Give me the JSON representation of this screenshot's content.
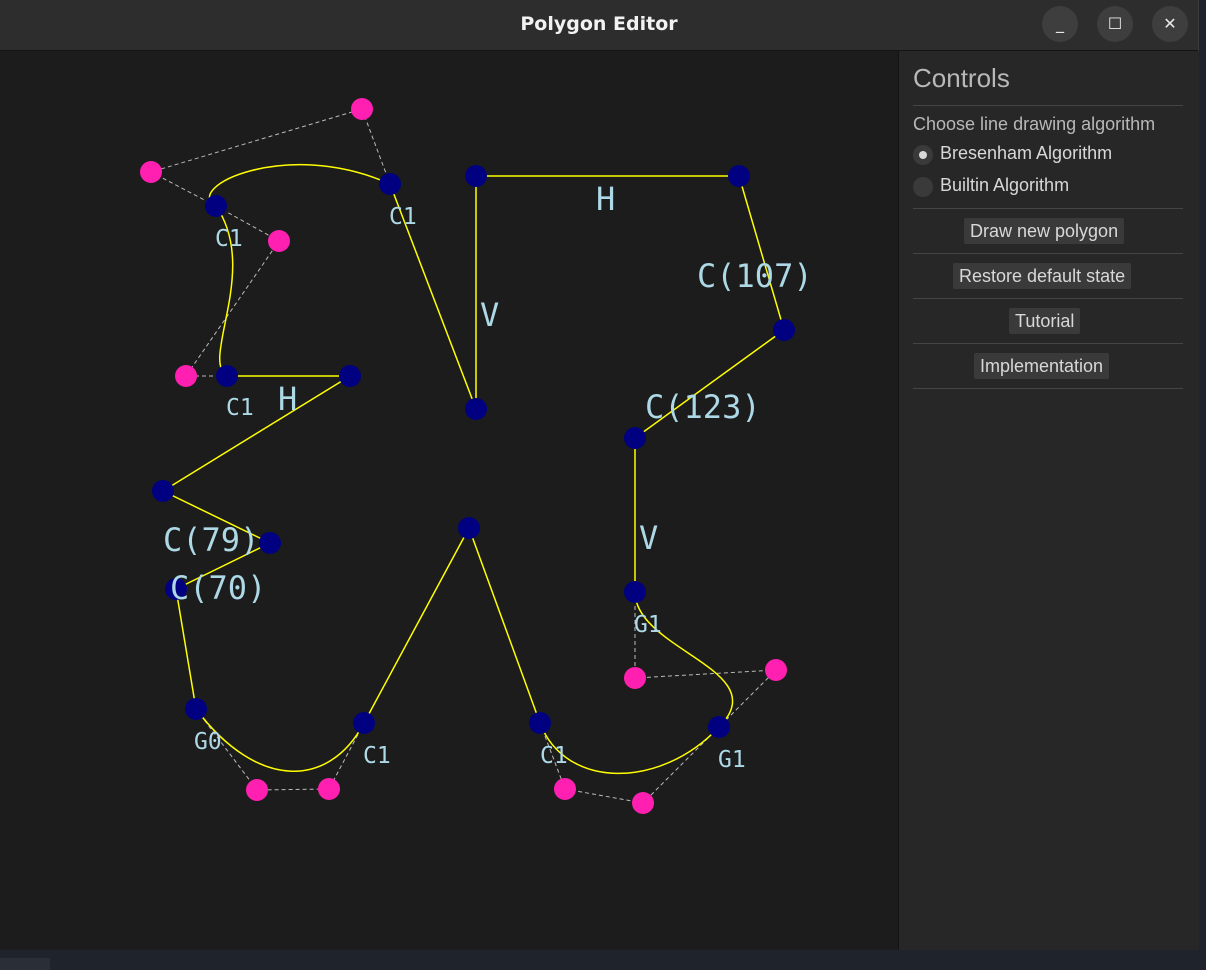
{
  "window": {
    "title": "Polygon Editor"
  },
  "window_controls": {
    "minimize": "_",
    "maximize": "☐",
    "close": "✕"
  },
  "colors": {
    "vertex": "#000080",
    "control_point": "#ff1fb0",
    "edge": "#ffff00",
    "control_line": "#bbbbbb",
    "label": "#add8e6",
    "canvas_bg": "#1c1c1c"
  },
  "controls": {
    "title": "Controls",
    "algorithm_label": "Choose line drawing algorithm",
    "algorithms": [
      {
        "label": "Bresenham Algorithm",
        "selected": true
      },
      {
        "label": "Builtin Algorithm",
        "selected": false
      }
    ],
    "buttons": {
      "draw_new": "Draw new polygon",
      "restore": "Restore default state",
      "tutorial": "Tutorial",
      "implementation": "Implementation"
    }
  },
  "polygon": {
    "labels": {
      "c1_a": "C1",
      "c1_b": "C1",
      "h_top": "H",
      "h_left": "H",
      "c1_c": "C1",
      "v_mid": "V",
      "c107": "C(107)",
      "c123": "C(123)",
      "c79": "C(79)",
      "c70": "C(70)",
      "v_right": "V",
      "g1_a": "G1",
      "g0": "G0",
      "c1_d": "C1",
      "c1_e": "C1",
      "g1_b": "G1"
    }
  }
}
